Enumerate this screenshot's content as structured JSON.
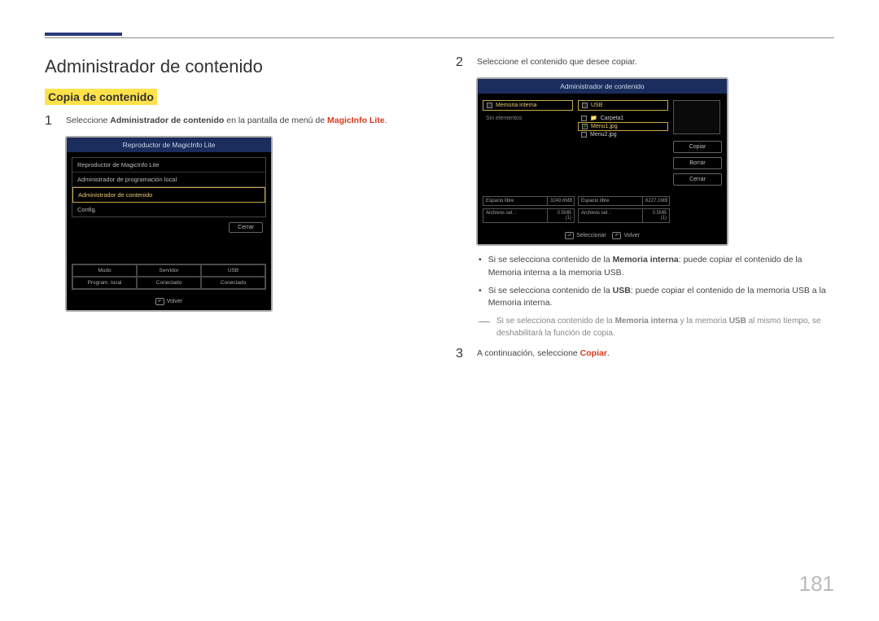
{
  "header": {
    "title": "Administrador de contenido"
  },
  "section": {
    "title": "Copia de contenido"
  },
  "steps": {
    "s1": {
      "num": "1",
      "pre": "Seleccione ",
      "bold": "Administrador de contenido",
      "mid": " en la pantalla de menú de ",
      "red": "MagicInfo Lite",
      "end": "."
    },
    "s2": {
      "num": "2",
      "text": "Seleccione el contenido que desee copiar."
    },
    "s3": {
      "num": "3",
      "pre": "A continuación, seleccione ",
      "red": "Copiar",
      "end": "."
    }
  },
  "screenshot1": {
    "title": "Reproductor de MagicInfo Lite",
    "items": [
      "Reproductor de MagicInfo Lite",
      "Administrador de programación local",
      "Administrador de contenido",
      "Config."
    ],
    "close_btn": "Cerrar",
    "status_headers": [
      "Modo",
      "Servidor",
      "USB"
    ],
    "status_values": [
      "Program. local",
      "Conectado",
      "Conectado"
    ],
    "footer": "Volver"
  },
  "screenshot2": {
    "title": "Administrador de contenido",
    "left_panel": {
      "title": "Memoria interna",
      "empty": "Sin elementos"
    },
    "right_panel": {
      "title": "USB",
      "items": [
        {
          "name": "Carpeta1",
          "checked": false,
          "folder": true,
          "selected": false
        },
        {
          "name": "Menu1.jpg",
          "checked": true,
          "folder": false,
          "selected": true
        },
        {
          "name": "Menu2.jpg",
          "checked": false,
          "folder": false,
          "selected": false
        }
      ]
    },
    "side_buttons": [
      "Copiar",
      "Borrar",
      "Cerrar"
    ],
    "fs_left": [
      {
        "label": "Espacio libre",
        "value": "3249.6MB"
      },
      {
        "label": "Archivos sel. :",
        "value": "0.5MB (1)"
      }
    ],
    "fs_right": [
      {
        "label": "Espacio libre",
        "value": "6227.1MB"
      },
      {
        "label": "Archivos sel. :",
        "value": "0.5MB (1)"
      }
    ],
    "footer_select": "Seleccionar",
    "footer_return": "Volver"
  },
  "bullets": {
    "b1": {
      "pre": "Si se selecciona contenido de la ",
      "b1": "Memoria interna",
      "mid1": ": puede copiar el contenido de la ",
      "r1": "Memoria interna",
      "mid2": " a la memoria ",
      "r2": "USB",
      "end": "."
    },
    "b2": {
      "pre": "Si se selecciona contenido de la ",
      "b1": "USB",
      "mid1": ": puede copiar el contenido de la memoria ",
      "r1": "USB",
      "mid2": " a la ",
      "r2": "Memoria interna",
      "end": "."
    }
  },
  "note": {
    "pre": "Si se selecciona contenido de la ",
    "b1": "Memoria interna",
    "mid1": " y la memoria ",
    "b2": "USB",
    "mid2": " al mismo tiempo, se deshabilitará la función de copia."
  },
  "page_number": "181"
}
